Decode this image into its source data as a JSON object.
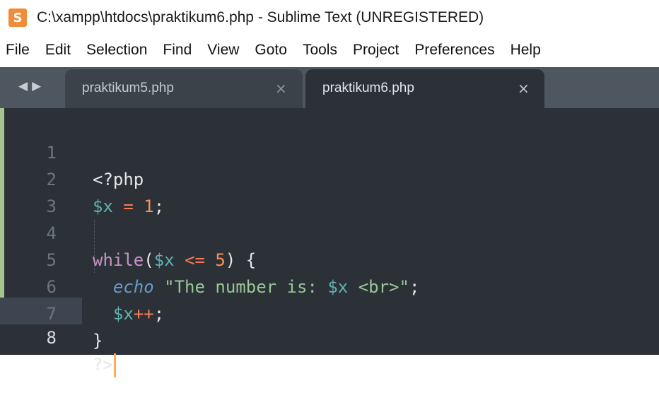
{
  "window": {
    "title": "C:\\xampp\\htdocs\\praktikum6.php - Sublime Text (UNREGISTERED)",
    "icon": "sublime-text-icon"
  },
  "menu": [
    "File",
    "Edit",
    "Selection",
    "Find",
    "View",
    "Goto",
    "Tools",
    "Project",
    "Preferences",
    "Help"
  ],
  "tabs": [
    {
      "label": "praktikum5.php",
      "active": false,
      "close": "×"
    },
    {
      "label": "praktikum6.php",
      "active": true,
      "close": "×"
    }
  ],
  "nav": {
    "back": "◀",
    "forward": "▶"
  },
  "editor": {
    "line_numbers": [
      "1",
      "2",
      "3",
      "4",
      "5",
      "6",
      "7",
      "8"
    ],
    "current_line": 8,
    "lines": [
      "<?php",
      "$x = 1;",
      "",
      "while($x <= 5) {",
      "  echo \"The number is: $x <br>\";",
      "  $x++;",
      "}",
      "?>"
    ]
  },
  "colors": {
    "editor_bg": "#2c3138",
    "tabbar_bg": "#4e5760",
    "keyword": "#c594c5",
    "variable": "#5fb3b3",
    "operator": "#f97b58",
    "number": "#f99157",
    "string": "#99c794",
    "function": "#6699cc",
    "cursor": "#f9ae58"
  }
}
